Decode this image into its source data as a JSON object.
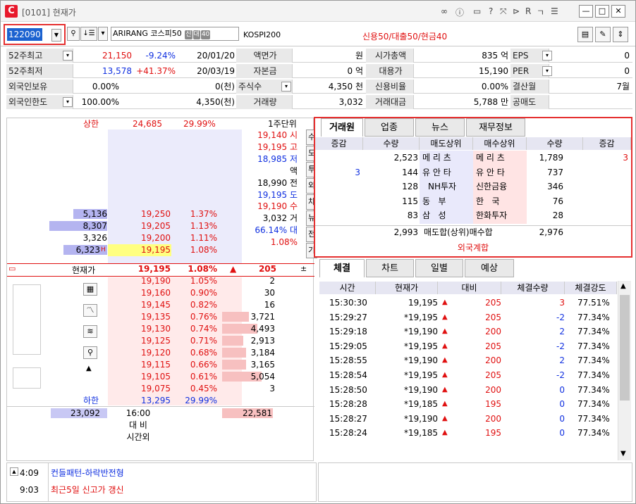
{
  "title": {
    "screen": "[0101] 현재가"
  },
  "toolbar": {
    "code": "122090",
    "name": "ARIRANG 코스피50",
    "badges": [
      "신",
      "대",
      "40"
    ],
    "index": "KOSPI200",
    "credit": "신용50/대출50/현금40"
  },
  "info": {
    "r1": {
      "l1": "52주최고",
      "v1": "21,150",
      "v2": "-9.24%",
      "v3": "20/01/20",
      "l2": "액면가",
      "v4": "원",
      "l3": "시가총액",
      "v5": "835 억",
      "l4": "EPS",
      "v6": "0"
    },
    "r2": {
      "l1": "52주최저",
      "v1": "13,578",
      "v2": "+41.37%",
      "v3": "20/03/19",
      "l2": "자본금",
      "v4": "0 억",
      "l3": "대용가",
      "v5": "15,190",
      "l4": "PER",
      "v6": "0"
    },
    "r3": {
      "l1": "외국인보유",
      "v1": "0.00%",
      "v3": "0(천)",
      "l2": "주식수",
      "v4": "4,350 천",
      "l3": "신용비율",
      "v5": "0.00%",
      "l4": "결산월",
      "v6": "7월"
    },
    "r4": {
      "l1": "외국인한도",
      "v1": "100.00%",
      "v3": "4,350(천)",
      "l2": "거래량",
      "v4": "3,032",
      "l3": "거래대금",
      "v5": "5,788 만",
      "l4": "공매도",
      "v6": ""
    }
  },
  "hoga": {
    "upper_label": "상한",
    "upper_price": "24,685",
    "upper_pct": "29.99%",
    "unit": "1주단위",
    "side_labels": [
      "19,140 시",
      "19,195 고",
      "18,985 저",
      "액",
      "18,990 전",
      "19,195 도",
      "19,190 수",
      "3,032 거",
      "66.14% 대",
      "1.08%"
    ],
    "vbtns": [
      "수",
      "도",
      "투",
      "외",
      "차",
      "뉴",
      "전",
      "기"
    ],
    "sell": [
      {
        "qty": "5,136",
        "price": "19,250",
        "pct": "1.37%"
      },
      {
        "qty": "8,307",
        "price": "19,205",
        "pct": "1.13%"
      },
      {
        "qty": "3,326",
        "price": "19,200",
        "pct": "1.11%"
      },
      {
        "qty": "6,323",
        "price": "19,195",
        "pct": "1.08%",
        "mark": "H"
      }
    ],
    "current": {
      "label": "현재가",
      "price": "19,195",
      "pct": "1.08%",
      "diff": "205"
    },
    "buy": [
      {
        "price": "19,190",
        "pct": "1.05%",
        "qty": "2"
      },
      {
        "price": "19,160",
        "pct": "0.90%",
        "qty": "30"
      },
      {
        "price": "19,145",
        "pct": "0.82%",
        "qty": "16"
      },
      {
        "price": "19,135",
        "pct": "0.76%",
        "qty": "3,721"
      },
      {
        "price": "19,130",
        "pct": "0.74%",
        "qty": "4,493"
      },
      {
        "price": "19,125",
        "pct": "0.71%",
        "qty": "2,913"
      },
      {
        "price": "19,120",
        "pct": "0.68%",
        "qty": "3,184"
      },
      {
        "price": "19,115",
        "pct": "0.66%",
        "qty": "3,165"
      },
      {
        "price": "19,105",
        "pct": "0.61%",
        "qty": "5,054"
      },
      {
        "price": "19,075",
        "pct": "0.45%",
        "qty": "3"
      }
    ],
    "lower_label": "하한",
    "lower_price": "13,295",
    "lower_pct": "29.99%",
    "total_sell": "23,092",
    "time": "16:00",
    "total_buy": "22,581",
    "daebi": "대 비",
    "after": "시간외"
  },
  "broker": {
    "tabs": [
      "거래원",
      "업종",
      "뉴스",
      "재무정보"
    ],
    "headers": [
      "증감",
      "수량",
      "매도상위",
      "매수상위",
      "수량",
      "증감"
    ],
    "rows": [
      {
        "sinc": "",
        "sqty": "2,523",
        "sname": "메 리 츠",
        "bname": "메 리 츠",
        "bqty": "1,789",
        "binc": "3"
      },
      {
        "sinc": "3",
        "sqty": "144",
        "sname": "유 안 타",
        "bname": "유 안 타",
        "bqty": "737",
        "binc": ""
      },
      {
        "sinc": "",
        "sqty": "128",
        "sname": "NH투자",
        "bname": "신한금융",
        "bqty": "346",
        "binc": ""
      },
      {
        "sinc": "",
        "sqty": "115",
        "sname": "동   부",
        "bname": "한   국",
        "bqty": "76",
        "binc": ""
      },
      {
        "sinc": "",
        "sqty": "83",
        "sname": "삼   성",
        "bname": "한화투자",
        "bqty": "28",
        "binc": ""
      }
    ],
    "sum_sell": "2,993",
    "sum_label": "매도합(상위)매수합",
    "sum_buy": "2,976",
    "foreign": "외국계합"
  },
  "trades": {
    "tabs": [
      "체결",
      "차트",
      "일별",
      "예상"
    ],
    "headers": [
      "시간",
      "현재가",
      "대비",
      "체결수량",
      "체결강도"
    ],
    "rows": [
      {
        "t": "15:30:30",
        "p": "19,195",
        "d": "205",
        "q": "3",
        "s": "77.51%",
        "qc": "red"
      },
      {
        "t": "15:29:27",
        "p": "*19,195",
        "d": "205",
        "q": "-2",
        "s": "77.34%",
        "qc": "blue"
      },
      {
        "t": "15:29:18",
        "p": "*19,190",
        "d": "200",
        "q": "2",
        "s": "77.34%",
        "qc": "blue"
      },
      {
        "t": "15:29:05",
        "p": "*19,195",
        "d": "205",
        "q": "-2",
        "s": "77.34%",
        "qc": "blue"
      },
      {
        "t": "15:28:55",
        "p": "*19,190",
        "d": "200",
        "q": "2",
        "s": "77.34%",
        "qc": "blue"
      },
      {
        "t": "15:28:54",
        "p": "*19,195",
        "d": "205",
        "q": "-2",
        "s": "77.34%",
        "qc": "blue"
      },
      {
        "t": "15:28:50",
        "p": "*19,190",
        "d": "200",
        "q": "0",
        "s": "77.34%",
        "qc": "blue"
      },
      {
        "t": "15:28:28",
        "p": "*19,185",
        "d": "195",
        "q": "0",
        "s": "77.34%",
        "qc": "blue"
      },
      {
        "t": "15:28:27",
        "p": "*19,190",
        "d": "200",
        "q": "0",
        "s": "77.34%",
        "qc": "blue"
      },
      {
        "t": "15:28:24",
        "p": "*19,185",
        "d": "195",
        "q": "0",
        "s": "77.34%",
        "qc": "blue"
      }
    ]
  },
  "news": [
    {
      "time": "4:09",
      "text": "컨들패턴-하락반전형",
      "color": "#1030e0"
    },
    {
      "time": "9:03",
      "text": "최근5일 신고가 갱신",
      "color": "#e01010"
    }
  ],
  "colors": {
    "red": "#e01010",
    "blue": "#1030e0",
    "highlight": "#e53030"
  }
}
